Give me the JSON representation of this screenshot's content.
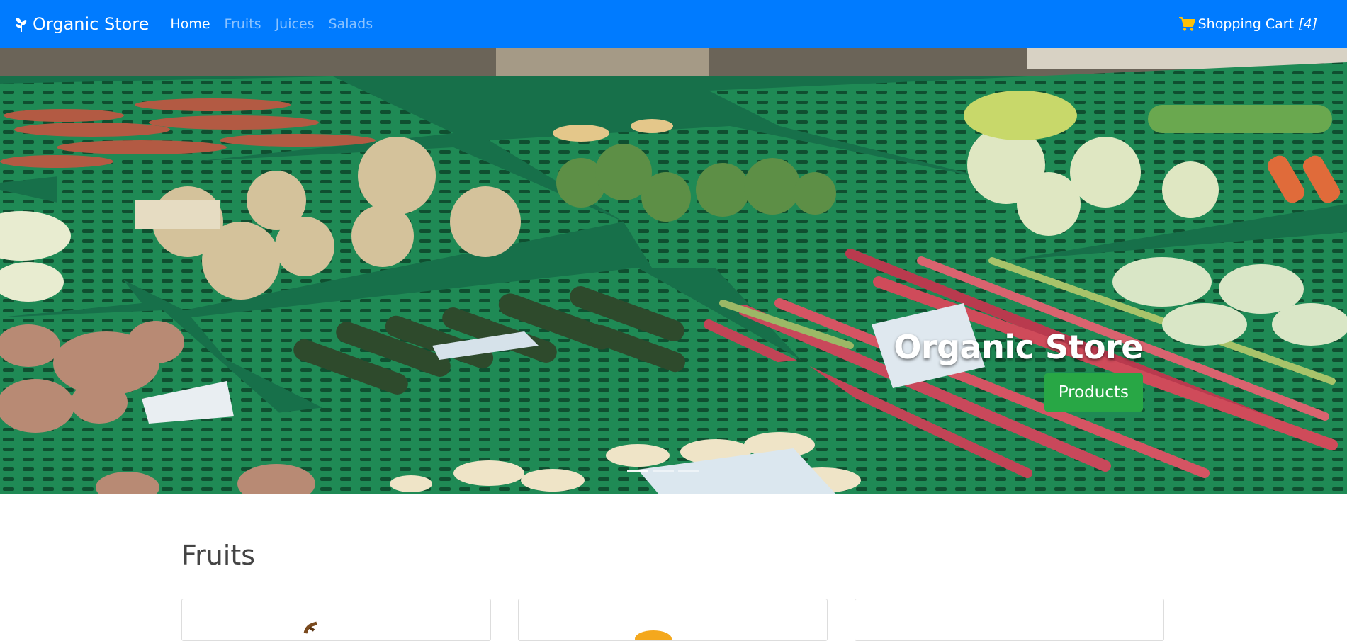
{
  "navbar": {
    "brand": "Organic Store",
    "links": [
      {
        "label": "Home",
        "active": true
      },
      {
        "label": "Fruits",
        "active": false
      },
      {
        "label": "Juices",
        "active": false
      },
      {
        "label": "Salads",
        "active": false
      }
    ],
    "cart_label": "Shopping Cart",
    "cart_count": "[4]"
  },
  "hero": {
    "title": "Organic Store",
    "button_label": "Products",
    "slides": 3,
    "active_slide": 1
  },
  "section": {
    "title": "Fruits"
  },
  "colors": {
    "navbar": "#007bff",
    "button": "#28a745",
    "cart_icon": "#ffc107"
  }
}
